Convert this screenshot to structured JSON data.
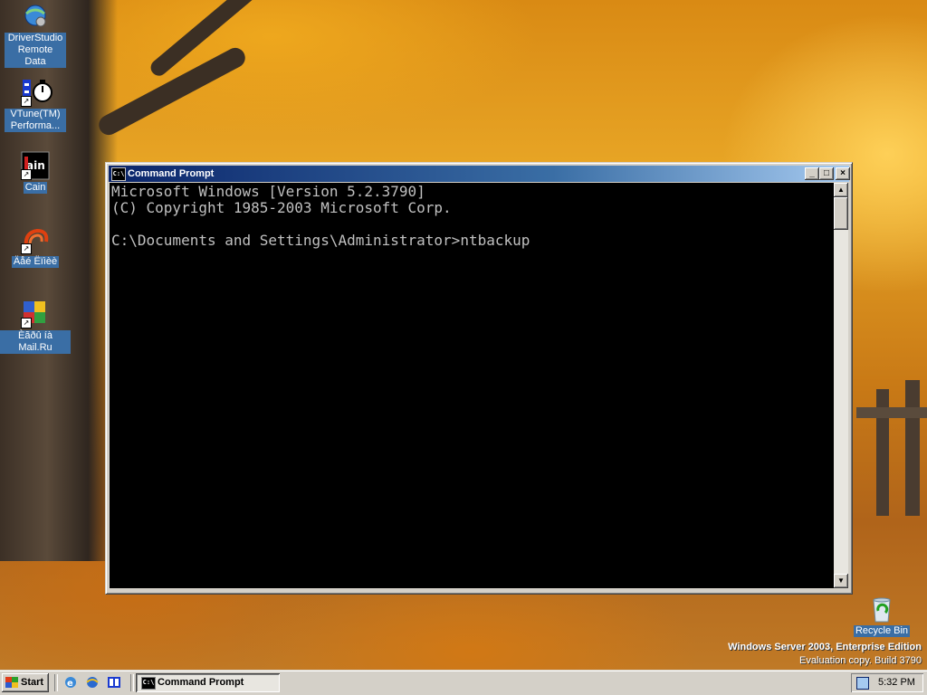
{
  "desktop": {
    "icons": [
      {
        "label": "DriverStudio Remote Data",
        "icon": "globe-network-icon"
      },
      {
        "label": "VTune(TM) Performa...",
        "icon": "stopwatch-icon"
      },
      {
        "label": "Cain",
        "icon": "cain-app-icon"
      },
      {
        "label": "Äåé Ëïìèè",
        "icon": "spiral-app-icon"
      },
      {
        "label": "Èãðû íà Mail.Ru",
        "icon": "mailru-games-icon"
      },
      {
        "label": "Recycle Bin",
        "icon": "recycle-bin-icon"
      }
    ],
    "watermark": {
      "edition": "Windows Server 2003, Enterprise Edition",
      "build": "Evaluation copy. Build 3790"
    }
  },
  "window": {
    "title": "Command Prompt",
    "icon_text": "C:\\",
    "console_lines": [
      "Microsoft Windows [Version 5.2.3790]",
      "(C) Copyright 1985-2003 Microsoft Corp.",
      "",
      "C:\\Documents and Settings\\Administrator>ntbackup"
    ],
    "buttons": {
      "minimize": "_",
      "maximize": "□",
      "close": "×"
    },
    "scroll_up": "▲",
    "scroll_down": "▼"
  },
  "taskbar": {
    "start_label": "Start",
    "quick_launch": [
      "ie-icon",
      "show-desktop-icon",
      "explorer-icon"
    ],
    "task_button_label": "Command Prompt",
    "clock": "5:32 PM"
  }
}
